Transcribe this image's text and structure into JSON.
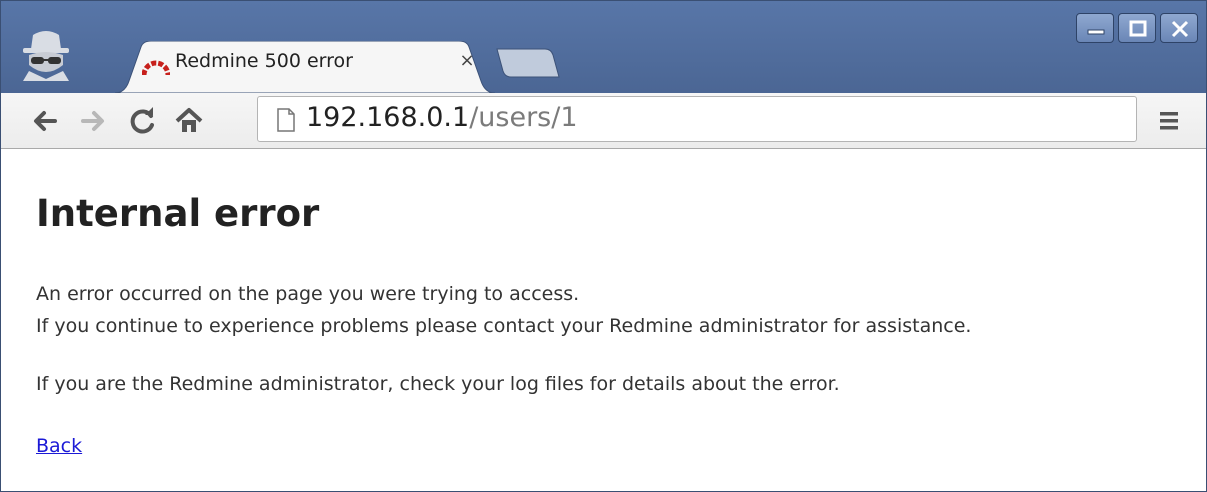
{
  "browser": {
    "tab": {
      "title": "Redmine 500 error",
      "close_glyph": "×",
      "favicon": "redmine-logo-icon"
    },
    "address_bar": {
      "url_host": "192.168.0.1",
      "url_path": "/users/1"
    },
    "icons": {
      "incognito": "incognito-icon",
      "back": "back-arrow-icon",
      "forward": "forward-arrow-icon",
      "reload": "reload-icon",
      "home": "home-icon",
      "page": "page-icon",
      "menu": "hamburger-menu-icon",
      "minimize": "minimize-icon",
      "maximize": "maximize-icon",
      "close": "close-icon"
    },
    "colors": {
      "frame": "#5876a8",
      "link": "#1b19d6",
      "favicon": "#c7201c"
    }
  },
  "page": {
    "heading": "Internal error",
    "paragraph_line_1": "An error occurred on the page you were trying to access.",
    "paragraph_line_2": "If you continue to experience problems please contact your Redmine administrator for assistance.",
    "paragraph_admin": "If you are the Redmine administrator, check your log files for details about the error.",
    "back_link": "Back"
  }
}
